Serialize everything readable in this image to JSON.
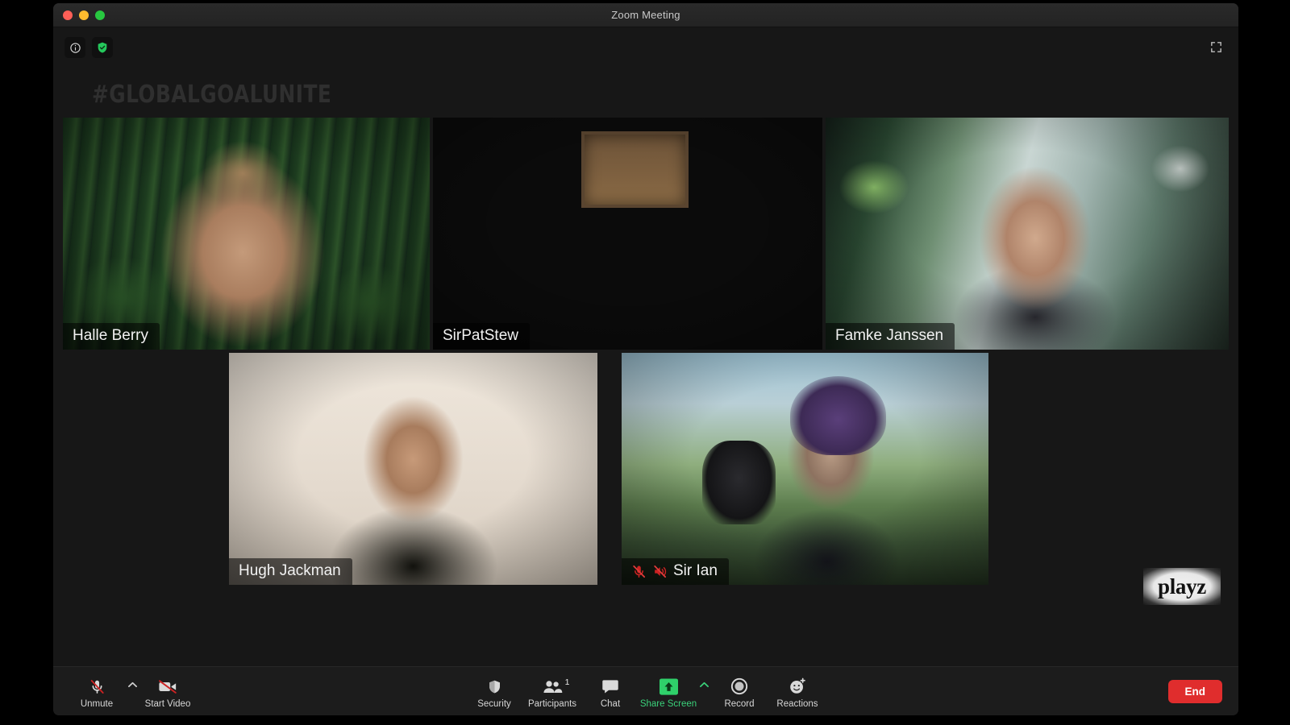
{
  "window": {
    "title": "Zoom Meeting",
    "traffic_lights": [
      "close-red",
      "minimize-yellow",
      "maximize-green"
    ],
    "fullscreen_icon": "fullscreen-icon"
  },
  "overlay": {
    "hashtag": "#GLOBALGOALUNITE",
    "watermark": "playz"
  },
  "status_bar": {
    "info_icon": "info-icon",
    "encryption_icon": "shield-check-icon"
  },
  "gallery": {
    "participants": [
      {
        "id": "halle",
        "name": "Halle Berry",
        "muted": false,
        "video_on": true,
        "row": 1
      },
      {
        "id": "patrick",
        "name": "SirPatStew",
        "muted": false,
        "video_on": true,
        "row": 1
      },
      {
        "id": "famke",
        "name": "Famke Janssen",
        "muted": false,
        "video_on": true,
        "row": 1
      },
      {
        "id": "hugh",
        "name": "Hugh Jackman",
        "muted": false,
        "video_on": true,
        "row": 2
      },
      {
        "id": "ian",
        "name": "Sir Ian",
        "muted": true,
        "video_on": true,
        "row": 2
      }
    ]
  },
  "toolbar": {
    "left": [
      {
        "label": "Unmute",
        "icon": "mic-muted-icon",
        "caret": true
      },
      {
        "label": "Start Video",
        "icon": "video-off-icon",
        "caret": false
      }
    ],
    "center": [
      {
        "label": "Security",
        "icon": "shield-icon",
        "badge": "",
        "active": false,
        "caret": false
      },
      {
        "label": "Participants",
        "icon": "participants-icon",
        "badge": "1",
        "active": false,
        "caret": false
      },
      {
        "label": "Chat",
        "icon": "chat-icon",
        "badge": "",
        "active": false,
        "caret": false
      },
      {
        "label": "Share Screen",
        "icon": "share-screen-icon",
        "badge": "",
        "active": true,
        "caret": true
      },
      {
        "label": "Record",
        "icon": "record-icon",
        "badge": "",
        "active": false,
        "caret": false
      },
      {
        "label": "Reactions",
        "icon": "reactions-icon",
        "badge": "",
        "active": false,
        "caret": false
      }
    ],
    "end_label": "End"
  },
  "colors": {
    "accent_green": "#3ad17a",
    "end_red": "#e02d2d",
    "mute_red": "#cc2222",
    "toolbar_bg": "#1c1c1c",
    "stage_bg": "#171717"
  }
}
